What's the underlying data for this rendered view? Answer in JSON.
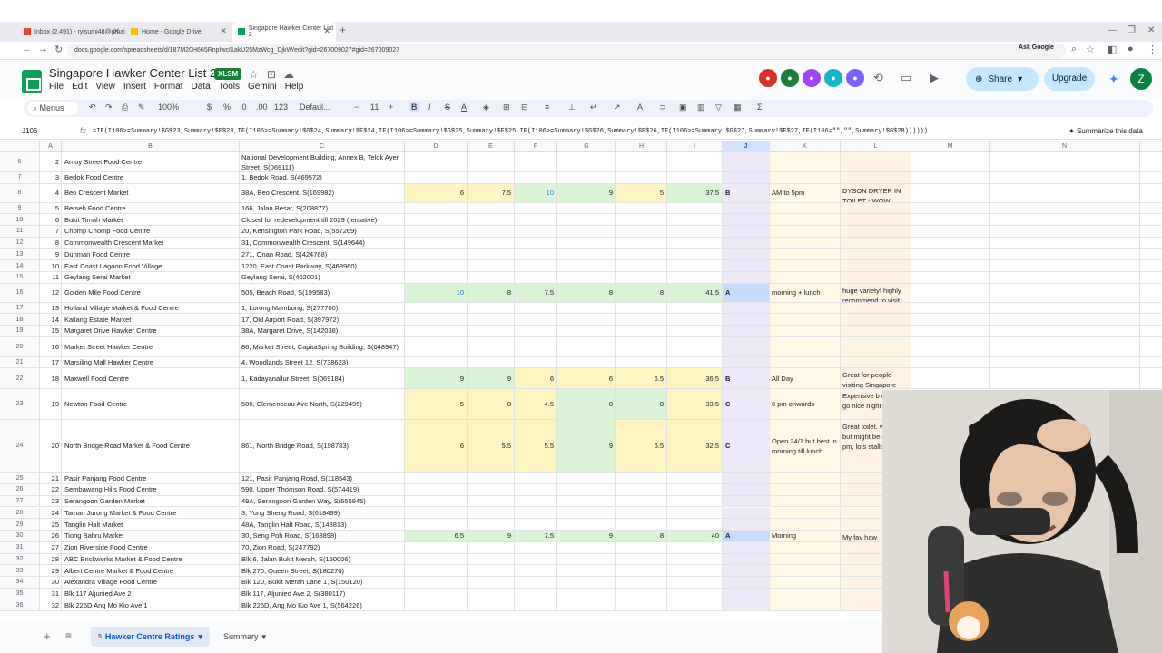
{
  "browser": {
    "tabs": [
      {
        "label": "Inbox (2,491) - ryisumi48@gmai",
        "color": "#ea4335"
      },
      {
        "label": "Home - Google Drive",
        "color": "#fbbc04"
      },
      {
        "label": "Singapore Hawker Center List 2",
        "color": "#0f9d58"
      }
    ],
    "url": "docs.google.com/spreadsheets/d/187M20H665RnpIwcI1akU25MzWcg_DjkW/edit?gid=267009027#gid=267009027",
    "ask_google": "Ask Google"
  },
  "doc": {
    "title": "Singapore Hawker Center List 2026",
    "badge": "XLSM",
    "menu": [
      "File",
      "Edit",
      "View",
      "Insert",
      "Format",
      "Data",
      "Tools",
      "Gemini",
      "Help"
    ],
    "share": "Share",
    "upgrade": "Upgrade",
    "profile_initial": "Z"
  },
  "toolbar": {
    "menus": "Menus",
    "zoom": "100%",
    "currency": "$",
    "percent": "%",
    "dec_less": ".0",
    "dec_more": ".00",
    "num_fmt": "123",
    "font": "Defaul...",
    "font_size": "11",
    "bold": "B",
    "italic": "I"
  },
  "formula_bar": {
    "cell": "J106",
    "fx": "fx",
    "formula": "=IF(I106>=Summary!$G$23,Summary!$F$23,IF(I106>=Summary!$G$24,Summary!$F$24,IF(I106>=Summary!$G$25,Summary!$F$25,IF(I106>=Summary!$G$26,Summary!$F$26,IF(I106>=Summary!$G$27,Summary!$F$27,IF(I106=\"\",\"\",Summary!$G$28))))))",
    "summarize": "Summarize this data"
  },
  "columns": [
    "A",
    "B",
    "C",
    "D",
    "E",
    "F",
    "G",
    "H",
    "I",
    "J",
    "K",
    "L",
    "M",
    "N"
  ],
  "rows": [
    {
      "rn": "6",
      "a": "2",
      "b": "Amoy Street Food Centre",
      "c": "National Development Building, Annex B, Telok Ayer Street, S(069111)",
      "d": "",
      "e": "",
      "f": "",
      "g": "",
      "h": "",
      "i": "",
      "j": "",
      "k": "",
      "l": ""
    },
    {
      "rn": "7",
      "a": "3",
      "b": "Bedok Food Centre",
      "c": "1, Bedok Road, S(469572)",
      "d": "",
      "e": "",
      "f": "",
      "g": "",
      "h": "",
      "i": "",
      "j": "",
      "k": "",
      "l": ""
    },
    {
      "rn": "8",
      "a": "4",
      "b": "Beo Crescent Market",
      "c": "38A, Beo Crescent, S(169982)",
      "d": "6",
      "e": "7.5",
      "f": "10",
      "g": "9",
      "h": "5",
      "i": "37.5",
      "j": "B",
      "k": "AM to 5pm",
      "l": "DYSON DRYER IN TOILET - WOW"
    },
    {
      "rn": "9",
      "a": "5",
      "b": "Berseh Food Centre",
      "c": "166, Jalan Besar, S(208877)",
      "d": "",
      "e": "",
      "f": "",
      "g": "",
      "h": "",
      "i": "",
      "j": "",
      "k": "",
      "l": ""
    },
    {
      "rn": "10",
      "a": "6",
      "b": "Bukit Timah Market",
      "c": "Closed for redevelopment till 2029 (tentative)",
      "d": "",
      "e": "",
      "f": "",
      "g": "",
      "h": "",
      "i": "",
      "j": "",
      "k": "",
      "l": ""
    },
    {
      "rn": "11",
      "a": "7",
      "b": "Chomp Chomp Food Centre",
      "c": "20, Kensington Park Road, S(557269)",
      "d": "",
      "e": "",
      "f": "",
      "g": "",
      "h": "",
      "i": "",
      "j": "",
      "k": "",
      "l": ""
    },
    {
      "rn": "12",
      "a": "8",
      "b": "Commonwealth Crescent Market",
      "c": "31, Commonwealth Crescent, S(149644)",
      "d": "",
      "e": "",
      "f": "",
      "g": "",
      "h": "",
      "i": "",
      "j": "",
      "k": "",
      "l": ""
    },
    {
      "rn": "13",
      "a": "9",
      "b": "Dunman Food Centre",
      "c": "271, Onan Road, S(424768)",
      "d": "",
      "e": "",
      "f": "",
      "g": "",
      "h": "",
      "i": "",
      "j": "",
      "k": "",
      "l": ""
    },
    {
      "rn": "14",
      "a": "10",
      "b": "East Coast Lagoon Food Village",
      "c": "1220, East Coast Parkway, S(468960)",
      "d": "",
      "e": "",
      "f": "",
      "g": "",
      "h": "",
      "i": "",
      "j": "",
      "k": "",
      "l": ""
    },
    {
      "rn": "15",
      "a": "11",
      "b": "Geylang Serai Market",
      "c": "Geylang Serai, S(402001)",
      "d": "",
      "e": "",
      "f": "",
      "g": "",
      "h": "",
      "i": "",
      "j": "",
      "k": "",
      "l": ""
    },
    {
      "rn": "16",
      "a": "12",
      "b": "Golden Mile Food Centre",
      "c": "505, Beach Road, S(199583)",
      "d": "10",
      "e": "8",
      "f": "7.5",
      "g": "8",
      "h": "8",
      "i": "41.5",
      "j": "A",
      "k": "morning + lunch",
      "l": "huge variety! highly recommend to visit"
    },
    {
      "rn": "17",
      "a": "13",
      "b": "Holland Village Market & Food Centre",
      "c": "1, Lorong Mambong, S(277700)",
      "d": "",
      "e": "",
      "f": "",
      "g": "",
      "h": "",
      "i": "",
      "j": "",
      "k": "",
      "l": ""
    },
    {
      "rn": "18",
      "a": "14",
      "b": "Kallang Estate Market",
      "c": "17, Old Airport Road, S(397972)",
      "d": "",
      "e": "",
      "f": "",
      "g": "",
      "h": "",
      "i": "",
      "j": "",
      "k": "",
      "l": ""
    },
    {
      "rn": "19",
      "a": "15",
      "b": "Margaret Drive Hawker Centre",
      "c": "38A, Margaret Drive, S(142038)",
      "d": "",
      "e": "",
      "f": "",
      "g": "",
      "h": "",
      "i": "",
      "j": "",
      "k": "",
      "l": ""
    },
    {
      "rn": "20",
      "a": "16",
      "b": "Market Street Hawker Centre",
      "c": "86, Market Street, CapitaSpring Building, S(048947)",
      "d": "",
      "e": "",
      "f": "",
      "g": "",
      "h": "",
      "i": "",
      "j": "",
      "k": "",
      "l": ""
    },
    {
      "rn": "21",
      "a": "17",
      "b": "Marsiling Mall Hawker Centre",
      "c": "4, Woodlands Street 12, S(738623)",
      "d": "",
      "e": "",
      "f": "",
      "g": "",
      "h": "",
      "i": "",
      "j": "",
      "k": "",
      "l": ""
    },
    {
      "rn": "22",
      "a": "18",
      "b": "Maxwell Food Centre",
      "c": "1, Kadayanallur Street, S(069184)",
      "d": "9",
      "e": "9",
      "f": "6",
      "g": "6",
      "h": "6.5",
      "i": "36.5",
      "j": "B",
      "k": "All Day",
      "l": "Great for people visiting Singapore"
    },
    {
      "rn": "23",
      "a": "19",
      "b": "Newton Food Centre",
      "c": "500, Clemenceau Ave North, S(229495)",
      "d": "5",
      "e": "8",
      "f": "4.5",
      "g": "8",
      "h": "8",
      "i": "33.5",
      "j": "C",
      "k": "6 pm onwards",
      "l": "Expensive b quality is go nice night vi"
    },
    {
      "rn": "24",
      "a": "20",
      "b": "North Bridge Road Market & Food Centre",
      "c": "861, North Bridge Road, S(198783)",
      "d": "6",
      "e": "5.5",
      "f": "5.5",
      "g": "9",
      "h": "6.5",
      "i": "32.5",
      "j": "C",
      "k": "Open 24/7 but best in morning till lunch",
      "l": "Great toilet. was mid but might be cu at 3 pm, lots stalls were c"
    },
    {
      "rn": "25",
      "a": "21",
      "b": "Pasir Panjang Food Centre",
      "c": "121, Pasir Panjang Road, S(118543)",
      "d": "",
      "e": "",
      "f": "",
      "g": "",
      "h": "",
      "i": "",
      "j": "",
      "k": "",
      "l": ""
    },
    {
      "rn": "26",
      "a": "22",
      "b": "Sembawang Hills Food Centre",
      "c": "590, Upper Thomson Road, S(574419)",
      "d": "",
      "e": "",
      "f": "",
      "g": "",
      "h": "",
      "i": "",
      "j": "",
      "k": "",
      "l": ""
    },
    {
      "rn": "27",
      "a": "23",
      "b": "Serangoon Garden Market",
      "c": "49A, Serangoon Garden Way, S(555945)",
      "d": "",
      "e": "",
      "f": "",
      "g": "",
      "h": "",
      "i": "",
      "j": "",
      "k": "",
      "l": ""
    },
    {
      "rn": "28",
      "a": "24",
      "b": "Taman Jurong Market & Food Centre",
      "c": "3, Yung Sheng Road, S(618499)",
      "d": "",
      "e": "",
      "f": "",
      "g": "",
      "h": "",
      "i": "",
      "j": "",
      "k": "",
      "l": ""
    },
    {
      "rn": "29",
      "a": "25",
      "b": "Tanglin Halt Market",
      "c": "48A, Tanglin Halt Road, S(148813)",
      "d": "",
      "e": "",
      "f": "",
      "g": "",
      "h": "",
      "i": "",
      "j": "",
      "k": "",
      "l": ""
    },
    {
      "rn": "30",
      "a": "26",
      "b": "Tiong Bahru Market",
      "c": "30, Seng Poh Road, S(168898)",
      "d": "6.5",
      "e": "9",
      "f": "7.5",
      "g": "9",
      "h": "8",
      "i": "40",
      "j": "A",
      "k": "Morning",
      "l": "My fav haw"
    },
    {
      "rn": "31",
      "a": "27",
      "b": "Zion Riverside Food Centre",
      "c": "70, Zion Road, S(247792)",
      "d": "",
      "e": "",
      "f": "",
      "g": "",
      "h": "",
      "i": "",
      "j": "",
      "k": "",
      "l": ""
    },
    {
      "rn": "32",
      "a": "28",
      "b": "ABC Brickworks Market & Food Centre",
      "c": "Blk 6, Jalan Bukit Merah, S(150006)",
      "d": "",
      "e": "",
      "f": "",
      "g": "",
      "h": "",
      "i": "",
      "j": "",
      "k": "",
      "l": ""
    },
    {
      "rn": "33",
      "a": "29",
      "b": "Albert Centre Market & Food Centre",
      "c": "Blk 270, Queen Street, S(180270)",
      "d": "",
      "e": "",
      "f": "",
      "g": "",
      "h": "",
      "i": "",
      "j": "",
      "k": "",
      "l": ""
    },
    {
      "rn": "34",
      "a": "30",
      "b": "Alexandra Village Food Centre",
      "c": "Blk 120, Bukit Merah Lane 1, S(150120)",
      "d": "",
      "e": "",
      "f": "",
      "g": "",
      "h": "",
      "i": "",
      "j": "",
      "k": "",
      "l": ""
    },
    {
      "rn": "35",
      "a": "31",
      "b": "Blk 117 Aljunied Ave 2",
      "c": "Blk 117, Aljunied Ave 2, S(380117)",
      "d": "",
      "e": "",
      "f": "",
      "g": "",
      "h": "",
      "i": "",
      "j": "",
      "k": "",
      "l": ""
    },
    {
      "rn": "36",
      "a": "32",
      "b": "Blk 226D Ang Mo Kio Ave 1",
      "c": "Blk 226D, Ang Mo Kio Ave 1, S(564226)",
      "d": "",
      "e": "",
      "f": "",
      "g": "",
      "h": "",
      "i": "",
      "j": "",
      "k": "",
      "l": ""
    }
  ],
  "sheets": {
    "active_count": "5",
    "active": "Hawker Centre Ratings",
    "other": "Summary"
  }
}
